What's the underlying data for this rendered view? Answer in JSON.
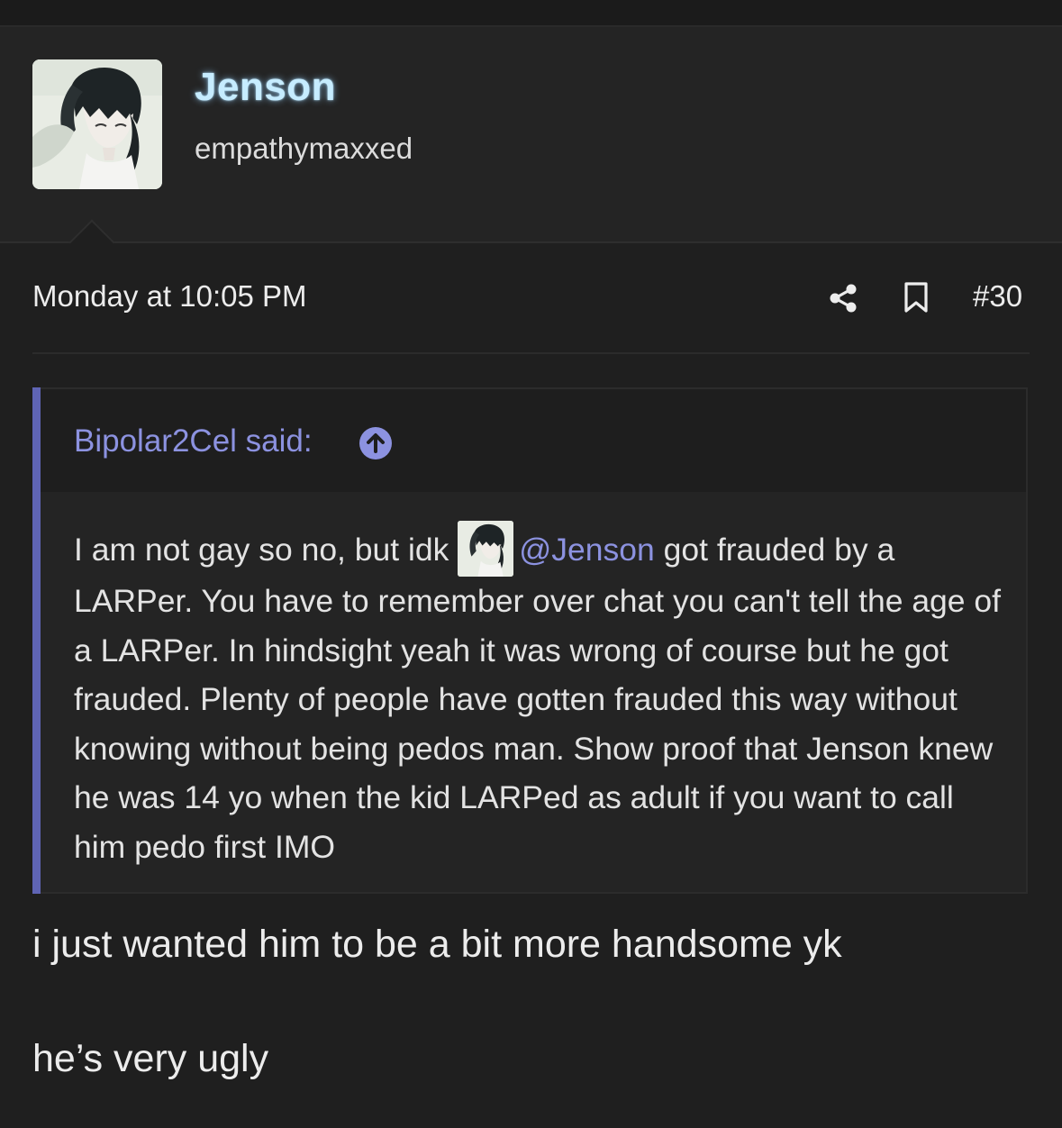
{
  "post": {
    "author": "Jenson",
    "user_title": "empathymaxxed",
    "timestamp": "Monday at 10:05 PM",
    "post_number": "#30",
    "avatar_icon": "anime-avatar-icon"
  },
  "quote": {
    "author_said": "Bipolar2Cel said:",
    "body_before_mention": "I am not gay so no, but idk",
    "mention": "@Jenson",
    "body_after_mention": " got frauded by a LARPer. You have to remember over chat you can't tell the age of a LARPer. In hindsight yeah it was wrong of course but he got frauded. Plenty of people have gotten frauded this way without knowing without being pedos man. Show proof that Jenson knew he was 14 yo when the kid LARPed as adult if you want to call him pedo first IMO"
  },
  "reply": {
    "line1": "i just wanted him to be a bit more handsome yk",
    "line2": "he’s very ugly"
  },
  "colors": {
    "background": "#1f1f1f",
    "header_bg": "#242424",
    "quote_accent": "#5f64b4",
    "link": "#8c92e0",
    "username_glow": "#c6ecff"
  }
}
